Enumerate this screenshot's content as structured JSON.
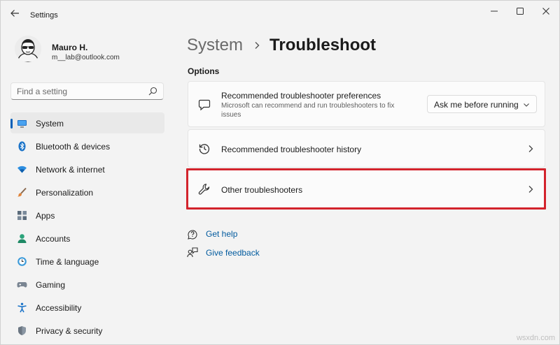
{
  "window": {
    "title": "Settings",
    "controls": {
      "minimize": "minimize",
      "maximize": "maximize",
      "close": "close"
    }
  },
  "profile": {
    "name": "Mauro H.",
    "email": "m__lab@outlook.com"
  },
  "search": {
    "placeholder": "Find a setting"
  },
  "sidebar": {
    "items": [
      {
        "label": "System",
        "icon": "monitor-icon",
        "selected": true
      },
      {
        "label": "Bluetooth & devices",
        "icon": "bluetooth-icon"
      },
      {
        "label": "Network & internet",
        "icon": "wifi-icon"
      },
      {
        "label": "Personalization",
        "icon": "brush-icon"
      },
      {
        "label": "Apps",
        "icon": "apps-icon"
      },
      {
        "label": "Accounts",
        "icon": "person-icon"
      },
      {
        "label": "Time & language",
        "icon": "globe-clock-icon"
      },
      {
        "label": "Gaming",
        "icon": "gamepad-icon"
      },
      {
        "label": "Accessibility",
        "icon": "accessibility-icon"
      },
      {
        "label": "Privacy & security",
        "icon": "shield-icon"
      }
    ]
  },
  "breadcrumb": {
    "parent": "System",
    "current": "Troubleshoot"
  },
  "options": {
    "section_label": "Options",
    "cards": [
      {
        "title": "Recommended troubleshooter preferences",
        "description": "Microsoft can recommend and run troubleshooters to fix issues",
        "dropdown_value": "Ask me before running",
        "icon": "chat-bubble-icon"
      },
      {
        "title": "Recommended troubleshooter history",
        "icon": "history-icon"
      },
      {
        "title": "Other troubleshooters",
        "icon": "wrench-icon",
        "highlighted": true
      }
    ]
  },
  "links": {
    "get_help": "Get help",
    "give_feedback": "Give feedback"
  },
  "colors": {
    "accent": "#005fb8",
    "link": "#005a9e",
    "highlight": "#d3232c",
    "background": "#f3f3f3",
    "card": "#fbfbfb"
  },
  "watermark": "wsxdn.com"
}
